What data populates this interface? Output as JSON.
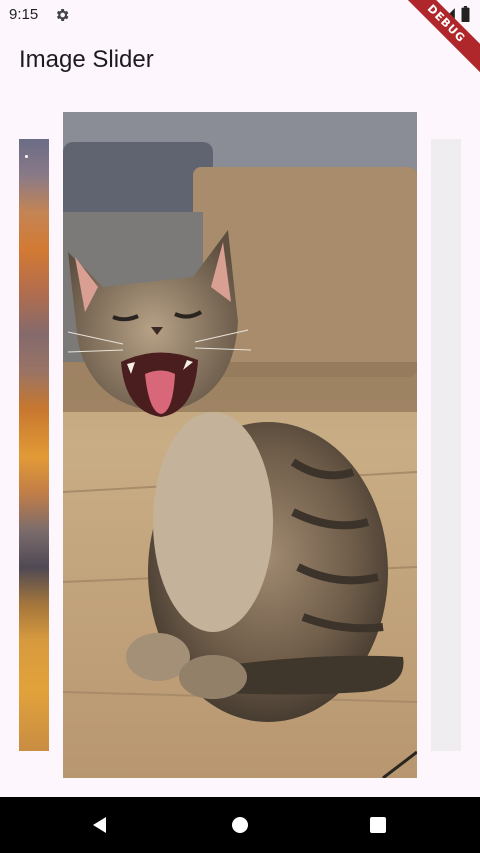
{
  "status_bar": {
    "time": "9:15",
    "icons": [
      "settings-gear-icon",
      "wifi-icon",
      "signal-icon",
      "battery-icon"
    ]
  },
  "debug_banner": {
    "label": "DEBUG"
  },
  "app_bar": {
    "title": "Image Slider"
  },
  "slider": {
    "slides": [
      {
        "position": "left",
        "visibility": "partial",
        "content": "sunset-sky-image"
      },
      {
        "position": "center",
        "visibility": "full",
        "content": "yawning-kitten-image"
      },
      {
        "position": "right",
        "visibility": "partial",
        "content": "loading-placeholder"
      }
    ]
  },
  "nav_bar": {
    "buttons": [
      "back-icon",
      "home-icon",
      "recents-icon"
    ]
  },
  "colors": {
    "background": "#fdf7fd",
    "debug_banner": "#b0272b",
    "nav_bar": "#000000",
    "placeholder": "#efedef"
  }
}
